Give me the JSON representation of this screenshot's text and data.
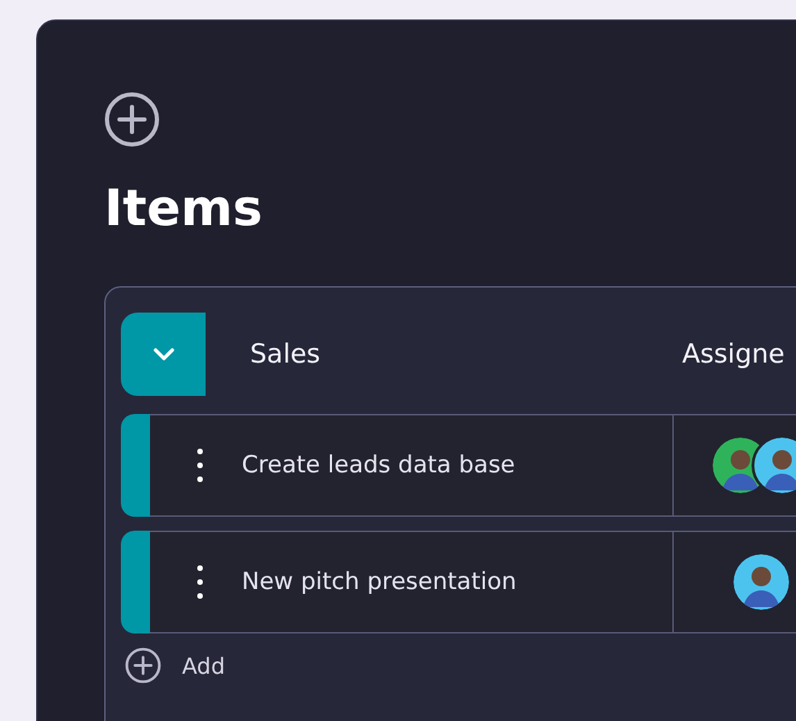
{
  "title": "Items",
  "group": {
    "name": "Sales",
    "expanded": true,
    "column": "Assigne",
    "items": [
      {
        "title": "Create leads data base",
        "assignees": [
          {
            "color": "#2fb35a"
          },
          {
            "color": "#4cc3ef"
          }
        ]
      },
      {
        "title": "New pitch presentation",
        "assignees": [
          {
            "color": "#4cc3ef"
          }
        ]
      }
    ],
    "add_label": "Add"
  }
}
